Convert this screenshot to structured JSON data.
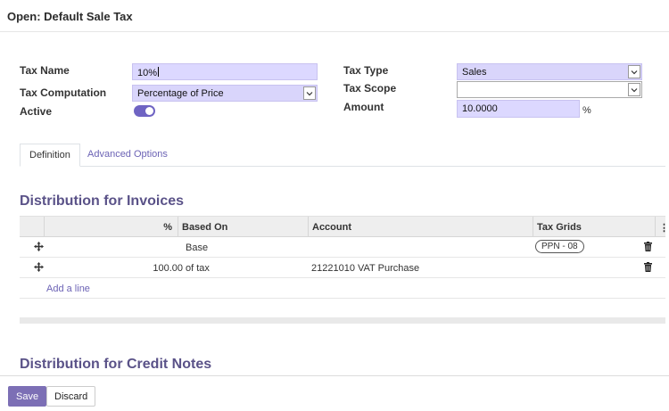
{
  "header": {
    "title": "Open: Default Sale Tax"
  },
  "form": {
    "tax_name_label": "Tax Name",
    "tax_name_value": "10%",
    "tax_computation_label": "Tax Computation",
    "tax_computation_value": "Percentage of Price",
    "active_label": "Active",
    "active_on": true,
    "tax_type_label": "Tax Type",
    "tax_type_value": "Sales",
    "tax_scope_label": "Tax Scope",
    "tax_scope_value": "",
    "amount_label": "Amount",
    "amount_value": "10.0000",
    "amount_unit": "%"
  },
  "tabs": [
    {
      "label": "Definition",
      "active": true
    },
    {
      "label": "Advanced Options",
      "active": false
    }
  ],
  "invoices": {
    "title": "Distribution for Invoices",
    "columns": {
      "percent": "%",
      "based_on": "Based On",
      "account": "Account",
      "tax_grids": "Tax Grids",
      "menu": "⋮"
    },
    "rows": [
      {
        "percent": "",
        "based_on": "Base",
        "account": "",
        "tax_grid": "PPN - 08"
      },
      {
        "percent": "100.00",
        "based_on": "of tax",
        "account": "21221010 VAT Purchase",
        "tax_grid": ""
      }
    ],
    "add_line": "Add a line"
  },
  "credit_notes": {
    "title": "Distribution for Credit Notes"
  },
  "footer": {
    "save_label": "Save",
    "discard_label": "Discard"
  },
  "colors": {
    "accent": "#7c6fb5",
    "field_bg": "#dcd8ff",
    "link": "#6c63b5"
  }
}
